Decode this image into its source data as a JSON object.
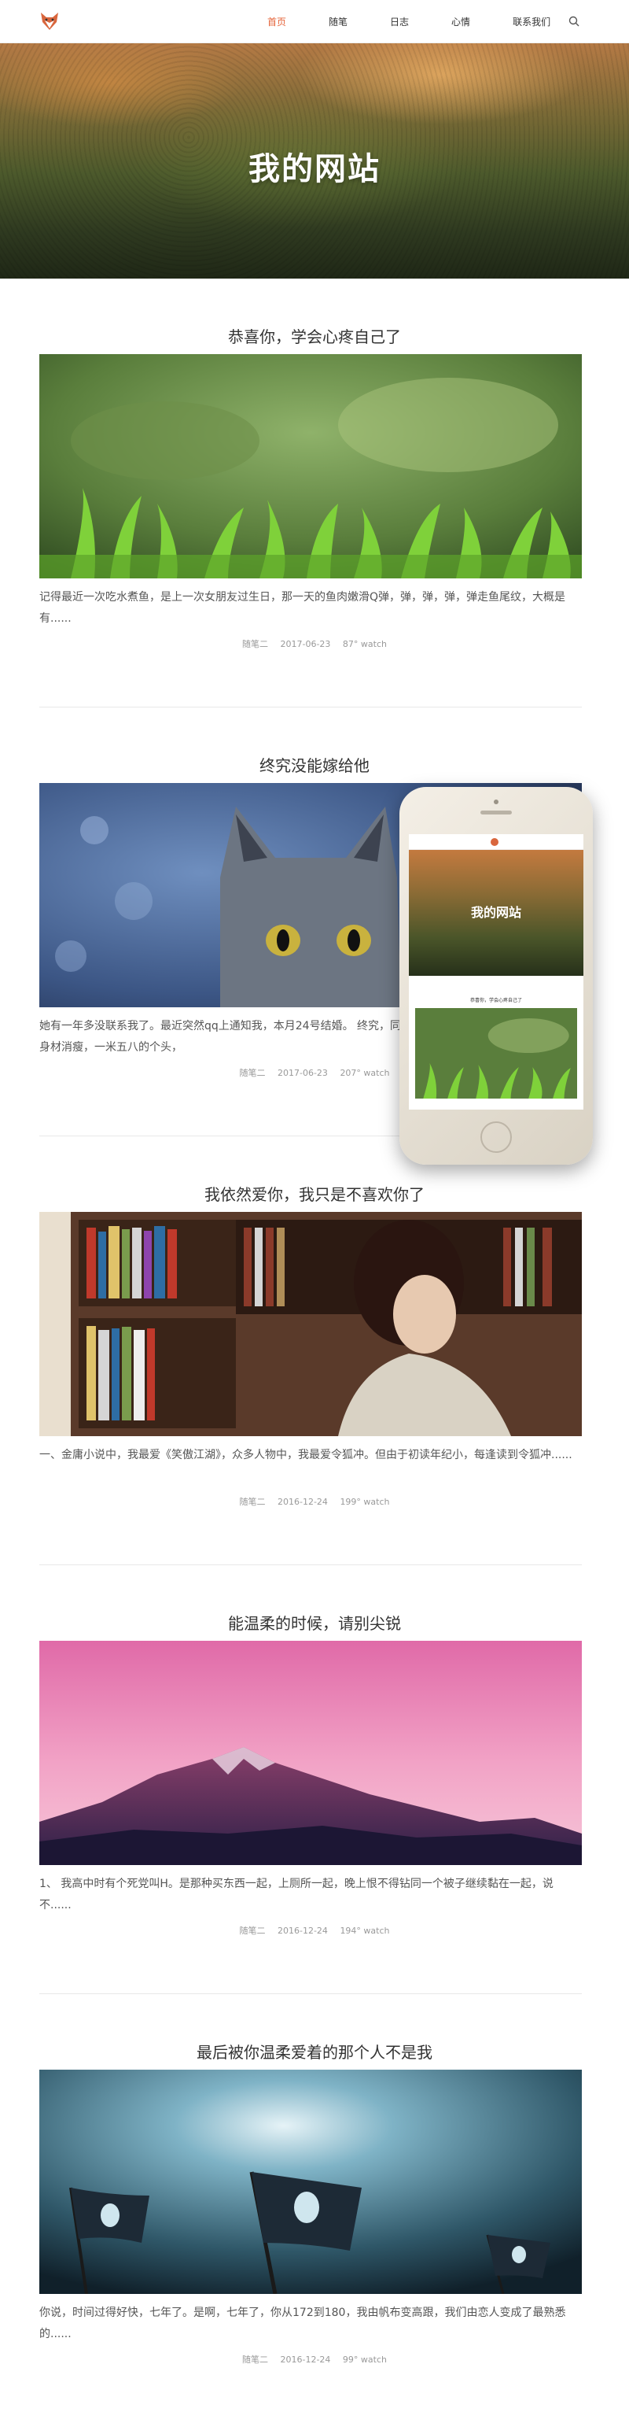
{
  "header": {
    "logo": "fox-logo-icon",
    "nav": [
      "首页",
      "随笔",
      "日志",
      "心情",
      "联系我们"
    ],
    "active_index": 0,
    "search": "search-icon"
  },
  "hero": {
    "title": "我的网站"
  },
  "posts": [
    {
      "title": "恭喜你，学会心疼自己了",
      "image": "grass-image",
      "excerpt": "记得最近一次吃水煮鱼，是上一次女朋友过生日，那一天的鱼肉嫩滑Q弹，弹，弹，弹，弹走鱼尾纹，大概是有......",
      "category": "随笔二",
      "date": "2017-06-23",
      "watch": "87° watch"
    },
    {
      "title": "终究没能嫁给他",
      "image": "cat-image",
      "excerpt": "她有一年多没联系我了。最近突然qq上通知我，本月24号结婚。 终究，同班不同宿舍。她叫媛媛，相貌一般，身材消瘦，一米五八的个头，",
      "category": "随笔二",
      "date": "2017-06-23",
      "watch": "207° watch"
    },
    {
      "title": "我依然爱你，我只是不喜欢你了",
      "image": "library-image",
      "excerpt": "一、金庸小说中，我最爱《笑傲江湖》，众多人物中，我最爱令狐冲。但由于初读年纪小，每逢读到令狐冲......",
      "category": "随笔二",
      "date": "2016-12-24",
      "watch": "199° watch"
    },
    {
      "title": "能温柔的时候，请别尖锐",
      "image": "mountain-image",
      "excerpt": "1、 我高中时有个死党叫H。是那种买东西一起，上厕所一起，晚上恨不得钻同一个被子继续黏在一起，说不......",
      "category": "随笔二",
      "date": "2016-12-24",
      "watch": "194° watch"
    },
    {
      "title": "最后被你温柔爱着的那个人不是我",
      "image": "alien-flags-image",
      "excerpt": "你说，时间过得好快，七年了。是啊，七年了，你从172到180，我由帆布变高跟，我们由恋人变成了最熟悉的......",
      "category": "随笔二",
      "date": "2016-12-24",
      "watch": "99° watch"
    }
  ],
  "phone_mockup": {
    "hero_title": "我的网站",
    "post_title": "恭喜你，学会心疼自己了"
  },
  "colors": {
    "accent": "#e5643a",
    "text": "#333333",
    "meta": "#999999"
  }
}
